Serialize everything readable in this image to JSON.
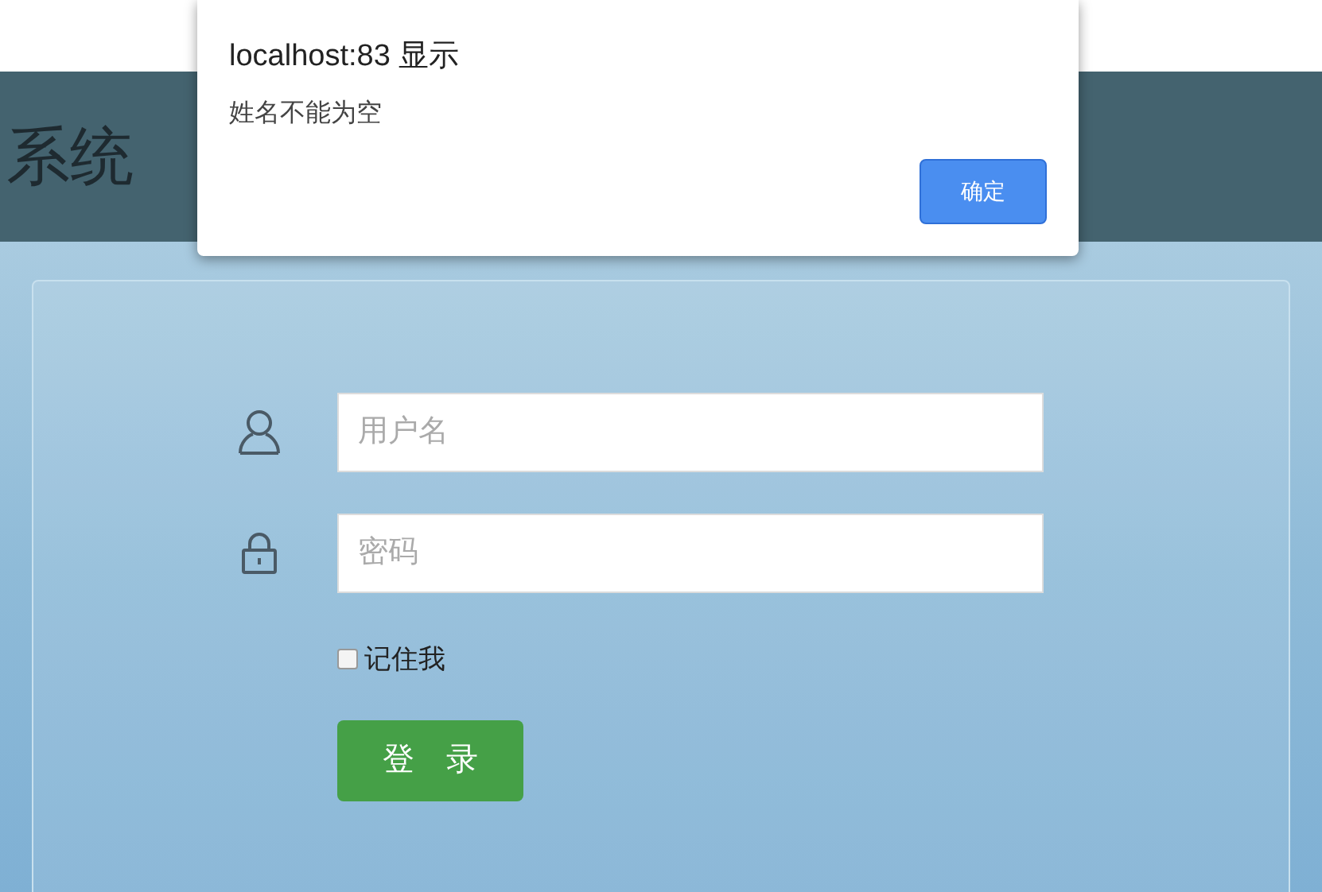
{
  "header": {
    "title": "系统"
  },
  "login_form": {
    "username": {
      "placeholder": "用户名"
    },
    "password": {
      "placeholder": "密码"
    },
    "remember": {
      "label": "记住我",
      "checked": false
    },
    "submit": "登　录"
  },
  "alert_dialog": {
    "title": "localhost:83 显示",
    "message": "姓名不能为空",
    "button": "确定"
  }
}
